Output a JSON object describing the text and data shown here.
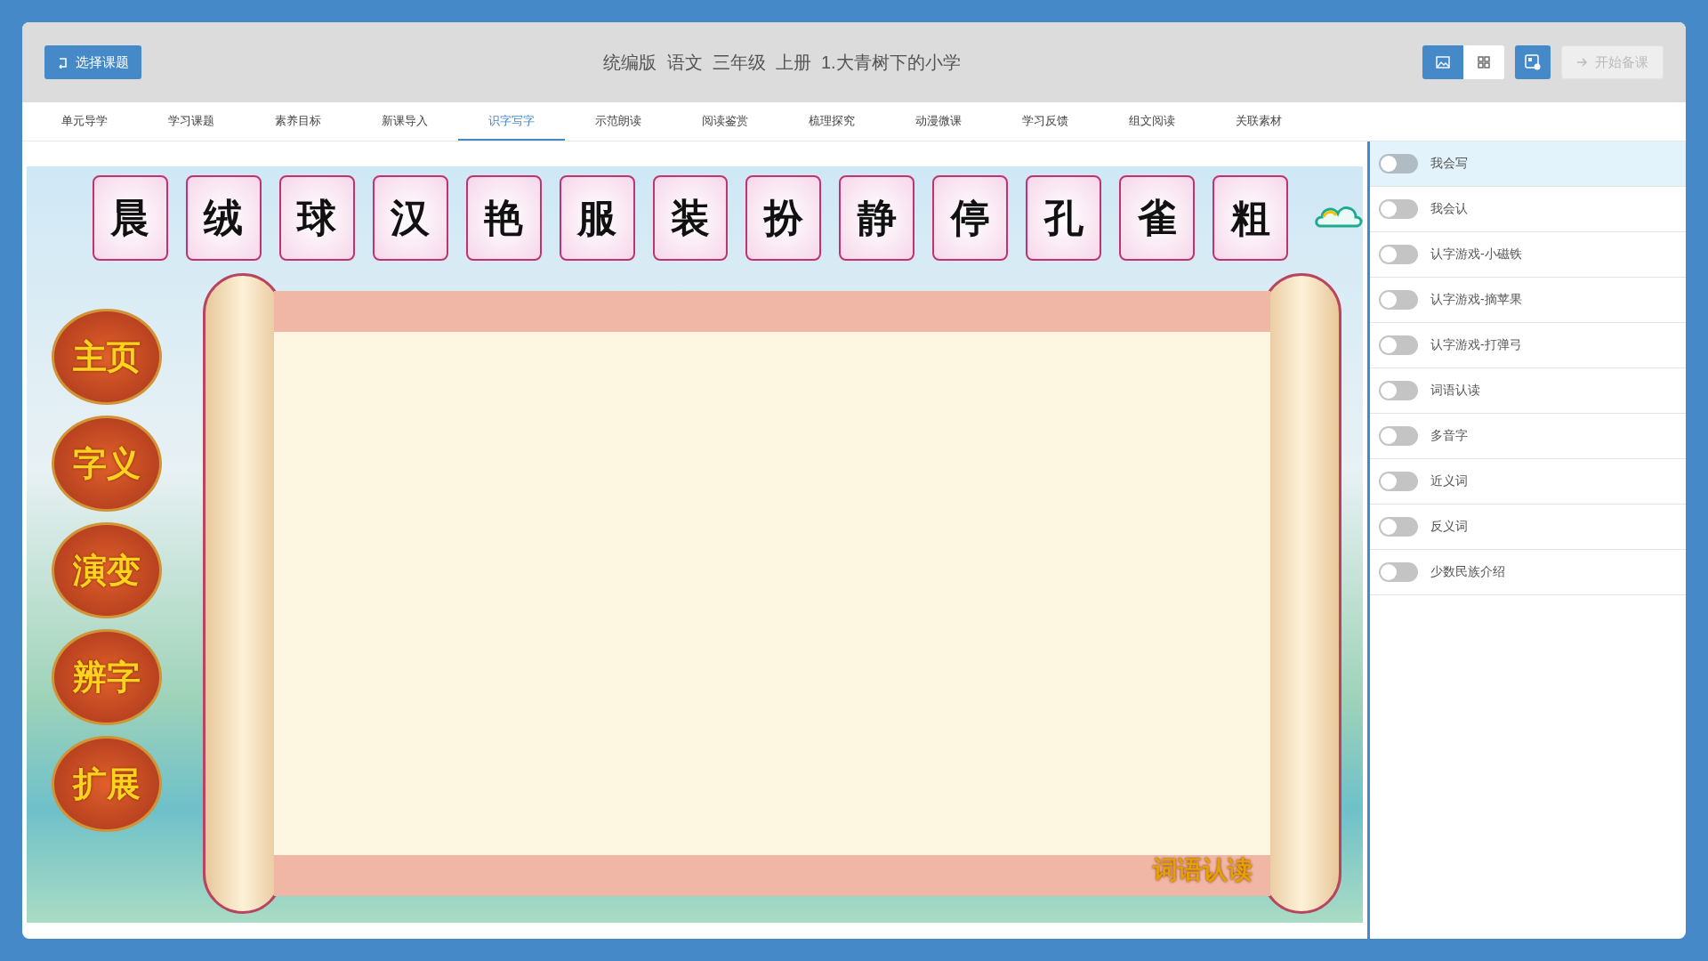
{
  "header": {
    "back_button": "选择课题",
    "title": "统编版  语文  三年级  上册  1.大青树下的小学",
    "view_toggle": [
      {
        "kind": "image",
        "selected": true
      },
      {
        "kind": "grid",
        "selected": false
      }
    ],
    "start_button": {
      "label": "开始备课",
      "disabled": true
    }
  },
  "tabs": [
    {
      "label": "单元导学",
      "selected": false
    },
    {
      "label": "学习课题",
      "selected": false
    },
    {
      "label": "素养目标",
      "selected": false
    },
    {
      "label": "新课导入",
      "selected": false
    },
    {
      "label": "识字写字",
      "selected": true
    },
    {
      "label": "示范朗读",
      "selected": false
    },
    {
      "label": "阅读鉴赏",
      "selected": false
    },
    {
      "label": "梳理探究",
      "selected": false
    },
    {
      "label": "动漫微课",
      "selected": false
    },
    {
      "label": "学习反馈",
      "selected": false
    },
    {
      "label": "组文阅读",
      "selected": false
    },
    {
      "label": "关联素材",
      "selected": false
    }
  ],
  "scene": {
    "characters": [
      "晨",
      "绒",
      "球",
      "汉",
      "艳",
      "服",
      "装",
      "扮",
      "静",
      "停",
      "孔",
      "雀",
      "粗"
    ],
    "lantern_menu": [
      "主页",
      "字义",
      "演变",
      "辨字",
      "扩展"
    ],
    "caption": "词语认读"
  },
  "sidebar": {
    "items": [
      {
        "label": "我会写",
        "selected": true,
        "on": false
      },
      {
        "label": "我会认",
        "selected": false,
        "on": false
      },
      {
        "label": "认字游戏-小磁铁",
        "selected": false,
        "on": false
      },
      {
        "label": "认字游戏-摘苹果",
        "selected": false,
        "on": false
      },
      {
        "label": "认字游戏-打弹弓",
        "selected": false,
        "on": false
      },
      {
        "label": "词语认读",
        "selected": false,
        "on": false
      },
      {
        "label": "多音字",
        "selected": false,
        "on": false
      },
      {
        "label": "近义词",
        "selected": false,
        "on": false
      },
      {
        "label": "反义词",
        "selected": false,
        "on": false
      },
      {
        "label": "少数民族介绍",
        "selected": false,
        "on": false
      }
    ]
  }
}
